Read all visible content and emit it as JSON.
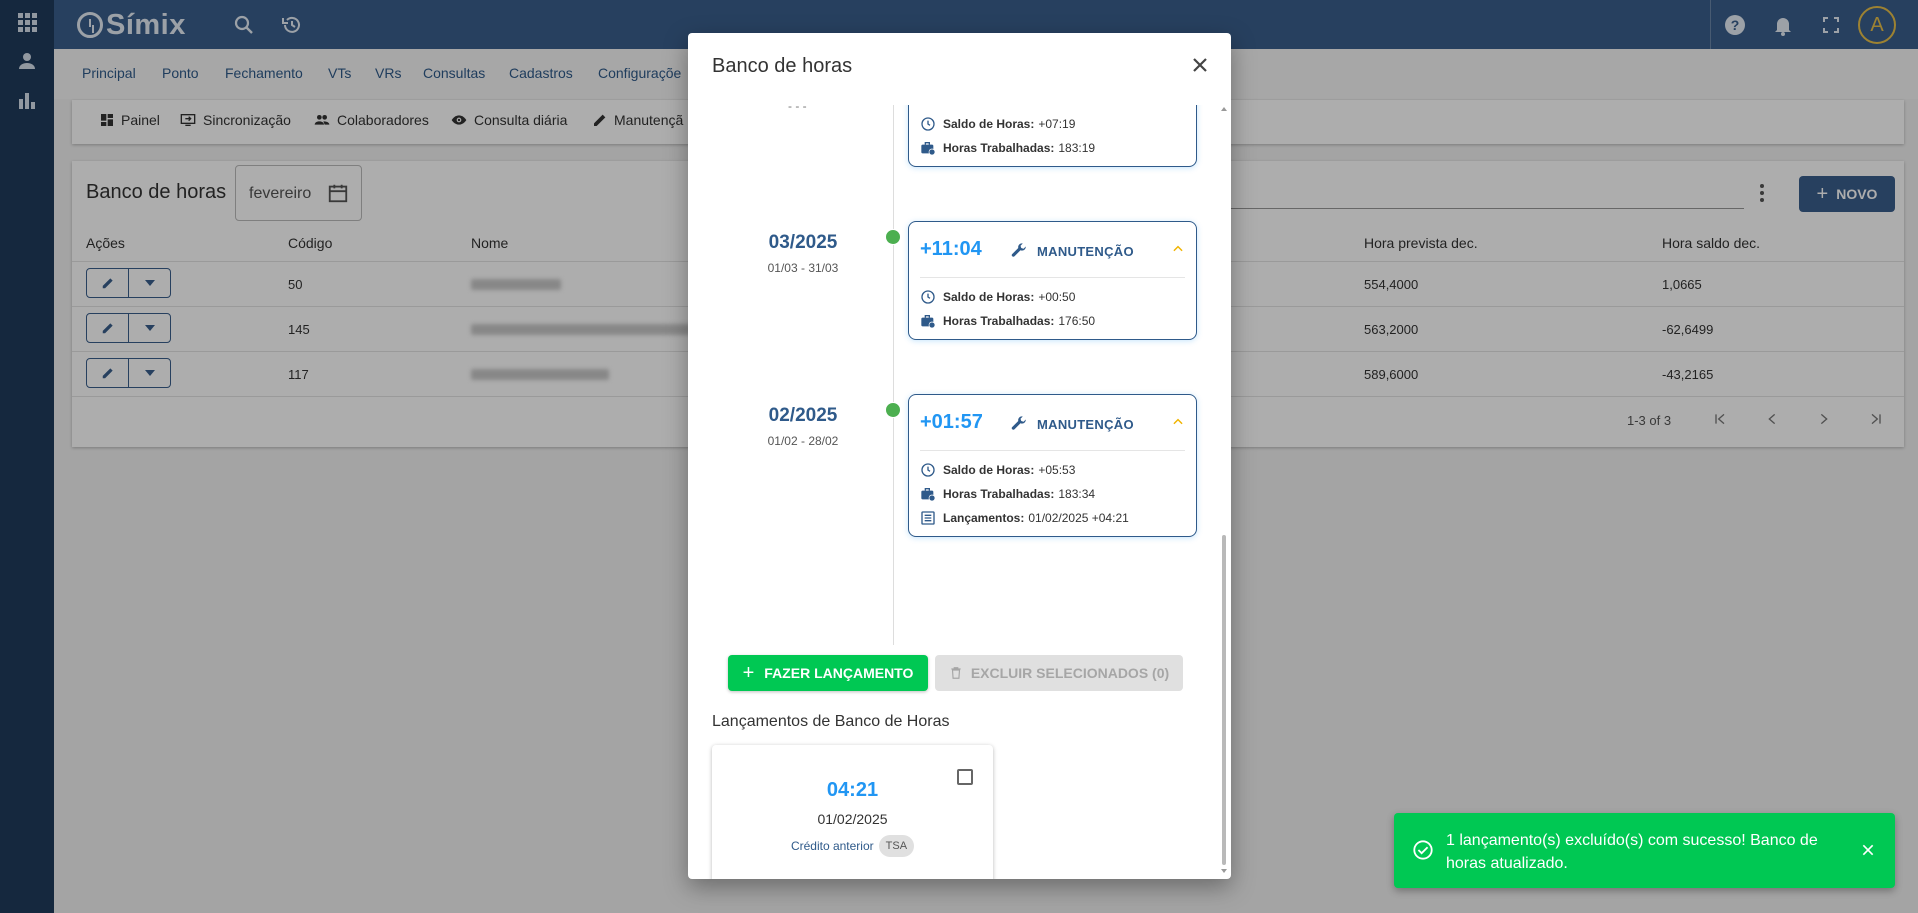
{
  "app": {
    "name": "Símix",
    "avatar_letter": "A"
  },
  "menu": [
    "Principal",
    "Ponto",
    "Fechamento",
    "VTs",
    "VRs",
    "Consultas",
    "Cadastros",
    "Configuraçõe"
  ],
  "subnav": [
    "Painel",
    "Sincronização",
    "Colaboradores",
    "Consulta diária",
    "Manutençã"
  ],
  "page": {
    "title": "Banco de horas",
    "month": "fevereiro",
    "new_button": "NOVO",
    "columns": [
      "Ações",
      "Código",
      "Nome",
      "Hora prevista dec.",
      "Hora saldo dec."
    ],
    "rows": [
      {
        "codigo": "50",
        "prevista": "554,4000",
        "saldo": "1,0665"
      },
      {
        "codigo": "145",
        "prevista": "563,2000",
        "saldo": "-62,6499"
      },
      {
        "codigo": "117",
        "prevista": "589,6000",
        "saldo": "-43,2165"
      }
    ],
    "pagination": "1-3 of 3"
  },
  "modal": {
    "title": "Banco de horas",
    "partial_top": {
      "saldo_label": "Saldo de Horas:",
      "saldo": "+07:19",
      "trab_label": "Horas Trabalhadas:",
      "trab": "183:19"
    },
    "entries": [
      {
        "period": "03/2025",
        "range": "01/03 - 31/03",
        "balance": "+11:04",
        "tag": "MANUTENÇÃO",
        "saldo_label": "Saldo de Horas:",
        "saldo": "+00:50",
        "trab_label": "Horas Trabalhadas:",
        "trab": "176:50"
      },
      {
        "period": "02/2025",
        "range": "01/02 - 28/02",
        "balance": "+01:57",
        "tag": "MANUTENÇÃO",
        "saldo_label": "Saldo de Horas:",
        "saldo": "+05:53",
        "trab_label": "Horas Trabalhadas:",
        "trab": "183:34",
        "lanc_label": "Lançamentos:",
        "lanc": "01/02/2025 +04:21"
      }
    ],
    "btn_add": "FAZER LANÇAMENTO",
    "btn_delete": "EXCLUIR SELECIONADOS (0)",
    "section_title": "Lançamentos de Banco de Horas",
    "launch": {
      "hours": "04:21",
      "date": "01/02/2025",
      "type": "Crédito anterior",
      "chip": "TSA"
    }
  },
  "toast": {
    "message": "1 lançamento(s) excluído(s) com sucesso! Banco de horas atualizado."
  },
  "colors": {
    "primary": "#3a5f8c",
    "accent_blue": "#2196f3",
    "success": "#00c853",
    "dot": "#4caf50"
  }
}
